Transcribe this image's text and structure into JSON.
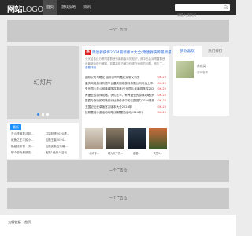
{
  "header": {
    "logo_main": "网站",
    "logo_sub": "LOGO",
    "nav": [
      "首页",
      "游戏攻略",
      "资讯"
    ],
    "search_placeholder": "请输入搜索词"
  },
  "ads": {
    "label": "一个广告位"
  },
  "slider": {
    "label": "幻灯片"
  },
  "latest": {
    "tab": "最新",
    "items": [
      "开山怪兽复活如...",
      "口袋妖怪2020漂...",
      "咸鱼之王平民小...",
      "瓦斯王者2024...",
      "隐藏线条第一次...",
      "瓦斯克勒官方最...",
      "哪个游戏最新攻...",
      "迷路1级升人活动..."
    ]
  },
  "center": {
    "hot_badge": "热",
    "headline": "隋唐群侠传2024最新版本大全(隋唐群侠传最新最全版本2023)",
    "summary": "今天给各位分享隋唐群侠传最新版本的知识，其中也会对隋唐群侠传最新版进行解释，如果能碰巧解决你现在面临的问题，别忘了...",
    "more": "查看详细",
    "news": [
      {
        "title": "国际公司鸟格花 国际公司鸟格花奈帝艾莉安",
        "date": "06-25"
      },
      {
        "title": "重庆网络游戏有限平台重庆网络游戏有限公司电话上市公司",
        "date": "06-25"
      },
      {
        "title": "失乐园少年公网最强阵容推荐(失乐园少年最强阵容2024年)",
        "date": "06-25"
      },
      {
        "title": "养蛊虫的游戏攻略，梦幻上手，有养蛊虫的游戏攻略(梦幻传奇)",
        "date": "06-25"
      },
      {
        "title": "匠匠与旅行的双境圣行仙尊传说中的王国强力2024最新攻略",
        "date": "06-25"
      },
      {
        "title": "王国纪元安卓版官方版本大全2024年",
        "date": "06-25"
      },
      {
        "title": "妖精童话手游活动攻略(妖精童话活动2024年)",
        "date": "06-25"
      }
    ],
    "thumbs": [
      "水浒传...",
      "敢为天下先...",
      "诸侯...",
      "天堂2..."
    ]
  },
  "right": {
    "tabs": [
      "猜你喜欢",
      "热门排行"
    ],
    "rec_category": "养成类",
    "rec_name": "游戏名称"
  },
  "footer": {
    "label": "友情链接",
    "link": "首页"
  }
}
